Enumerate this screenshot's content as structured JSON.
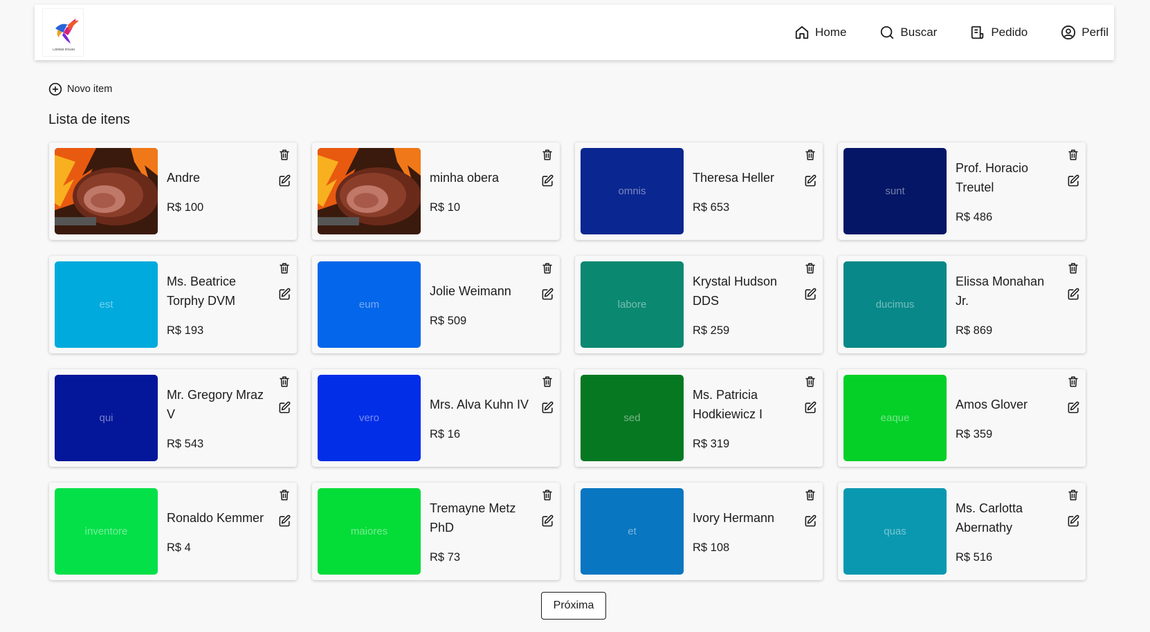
{
  "header": {
    "logo_text": "LOREM IPSUM",
    "nav": [
      {
        "label": "Home",
        "icon": "home-icon"
      },
      {
        "label": "Buscar",
        "icon": "search-icon"
      },
      {
        "label": "Pedido",
        "icon": "receipt-icon"
      },
      {
        "label": "Perfil",
        "icon": "user-circle-icon"
      }
    ]
  },
  "actions": {
    "new_item_label": "Novo item"
  },
  "list": {
    "title": "Lista de itens",
    "items": [
      {
        "name": "Andre",
        "price": "R$ 100",
        "thumb_text": "",
        "thumb_color": "",
        "photo": true
      },
      {
        "name": "minha obera",
        "price": "R$ 10",
        "thumb_text": "",
        "thumb_color": "",
        "photo": true
      },
      {
        "name": "Theresa Heller",
        "price": "R$ 653",
        "thumb_text": "omnis",
        "thumb_color": "#0a2690",
        "photo": false
      },
      {
        "name": "Prof. Horacio Treutel",
        "price": "R$ 486",
        "thumb_text": "sunt",
        "thumb_color": "#041665",
        "photo": false
      },
      {
        "name": "Ms. Beatrice Torphy DVM",
        "price": "R$ 193",
        "thumb_text": "est",
        "thumb_color": "#00aadd",
        "photo": false
      },
      {
        "name": "Jolie Weimann",
        "price": "R$ 509",
        "thumb_text": "eum",
        "thumb_color": "#0466ea",
        "photo": false
      },
      {
        "name": "Krystal Hudson DDS",
        "price": "R$ 259",
        "thumb_text": "labore",
        "thumb_color": "#0a8870",
        "photo": false
      },
      {
        "name": "Elissa Monahan Jr.",
        "price": "R$ 869",
        "thumb_text": "ducimus",
        "thumb_color": "#088888",
        "photo": false
      },
      {
        "name": "Mr. Gregory Mraz V",
        "price": "R$ 543",
        "thumb_text": "qui",
        "thumb_color": "#04169a",
        "photo": false
      },
      {
        "name": "Mrs. Alva Kuhn IV",
        "price": "R$ 16",
        "thumb_text": "vero",
        "thumb_color": "#022ee8",
        "photo": false
      },
      {
        "name": "Ms. Patricia Hodkiewicz I",
        "price": "R$ 319",
        "thumb_text": "sed",
        "thumb_color": "#067822",
        "photo": false
      },
      {
        "name": "Amos Glover",
        "price": "R$ 359",
        "thumb_text": "eaque",
        "thumb_color": "#04d028",
        "photo": false
      },
      {
        "name": "Ronaldo Kemmer",
        "price": "R$ 4",
        "thumb_text": "inventore",
        "thumb_color": "#04e048",
        "photo": false
      },
      {
        "name": "Tremayne Metz PhD",
        "price": "R$ 73",
        "thumb_text": "maiores",
        "thumb_color": "#04dc38",
        "photo": false
      },
      {
        "name": "Ivory Hermann",
        "price": "R$ 108",
        "thumb_text": "et",
        "thumb_color": "#0876c0",
        "photo": false
      },
      {
        "name": "Ms. Carlotta Abernathy",
        "price": "R$ 516",
        "thumb_text": "quas",
        "thumb_color": "#0a98b0",
        "photo": false
      }
    ]
  },
  "pagination": {
    "next_label": "Próxima"
  }
}
